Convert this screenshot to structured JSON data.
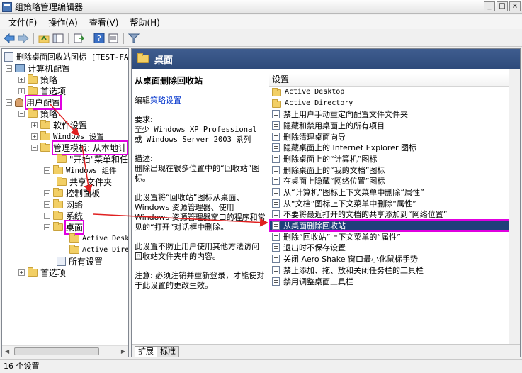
{
  "window": {
    "title": "组策略管理编辑器",
    "buttons": [
      "_",
      "□",
      "×"
    ]
  },
  "menu": [
    {
      "label": "文件(F)"
    },
    {
      "label": "操作(A)"
    },
    {
      "label": "查看(V)"
    },
    {
      "label": "帮助(H)"
    }
  ],
  "toolbar": [
    "back-arrow-icon",
    "forward-arrow-icon",
    "up-folder-icon",
    "show-hide-tree-icon",
    "export-list-icon",
    "help-icon",
    "properties-icon",
    "filter-icon"
  ],
  "tree": {
    "root": "删除桌面回收站图标 [TEST-FAI",
    "computer_config": "计算机配置",
    "policies": "策略",
    "preferences": "首选项",
    "user_config": "用户配置",
    "software_settings": "软件设置",
    "windows_settings": "Windows 设置",
    "admin_templates": "管理模板: 从本地计",
    "start_menu": "\"开始\"菜单和任",
    "windows_components": "Windows 组件",
    "shared_folders": "共享文件夹",
    "control_panel": "控制面板",
    "network": "网络",
    "system": "系统",
    "desktop": "桌面",
    "active_desktop": "Active Deskt",
    "active_directory": "Active Direc",
    "all_settings": "所有设置",
    "user_preferences": "首选项"
  },
  "pane": {
    "header": "桌面",
    "description": {
      "title": "从桌面删除回收站",
      "edit_prefix": "编辑",
      "edit_link": "策略设置",
      "requirements_label": "要求:",
      "requirements": "至少 Windows XP Professional 或 Windows Server 2003 系列",
      "desc_label": "描述:",
      "desc_text": "删除出现在很多位置中的“回收站”图标。",
      "para1": "此设置将“回收站”图标从桌面、Windows 资源管理器、使用 Windows 资源管理器窗口的程序和常见的“打开”对话框中删除。",
      "para2": "此设置不防止用户使用其他方法访问回收站文件夹中的内容。",
      "para3": "注意: 必须注销并重新登录，才能使对于此设置的更改生效。"
    },
    "list_header": "设置",
    "settings": [
      {
        "label": "Active Desktop",
        "type": "folder"
      },
      {
        "label": "Active Directory",
        "type": "folder"
      },
      {
        "label": "禁止用户手动重定向配置文件文件夹",
        "type": "setting"
      },
      {
        "label": "隐藏和禁用桌面上的所有项目",
        "type": "setting"
      },
      {
        "label": "删除清理桌面向导",
        "type": "setting"
      },
      {
        "label": "隐藏桌面上的 Internet Explorer 图标",
        "type": "setting"
      },
      {
        "label": "删除桌面上的“计算机”图标",
        "type": "setting"
      },
      {
        "label": "删除桌面上的“我的文档”图标",
        "type": "setting"
      },
      {
        "label": "在桌面上隐藏“网络位置”图标",
        "type": "setting"
      },
      {
        "label": "从“计算机”图标上下文菜单中删除“属性”",
        "type": "setting"
      },
      {
        "label": "从“文档”图标上下文菜单中删除“属性”",
        "type": "setting"
      },
      {
        "label": "不要将最近打开的文档的共享添加到“网络位置”",
        "type": "setting"
      },
      {
        "label": "从桌面删除回收站",
        "type": "setting",
        "selected": true
      },
      {
        "label": "删除“回收站”上下文菜单的“属性”",
        "type": "setting"
      },
      {
        "label": "退出时不保存设置",
        "type": "setting"
      },
      {
        "label": "关闭 Aero Shake 窗口最小化鼠标手势",
        "type": "setting"
      },
      {
        "label": "禁止添加、拖、放和关闭任务栏的工具栏",
        "type": "setting"
      },
      {
        "label": "禁用调整桌面工具栏",
        "type": "setting"
      }
    ],
    "tabs": [
      {
        "label": "扩展"
      },
      {
        "label": "标准"
      }
    ]
  },
  "status": "16 个设置",
  "annotation_color": "#e000e0",
  "arrow_color": "#e02020"
}
